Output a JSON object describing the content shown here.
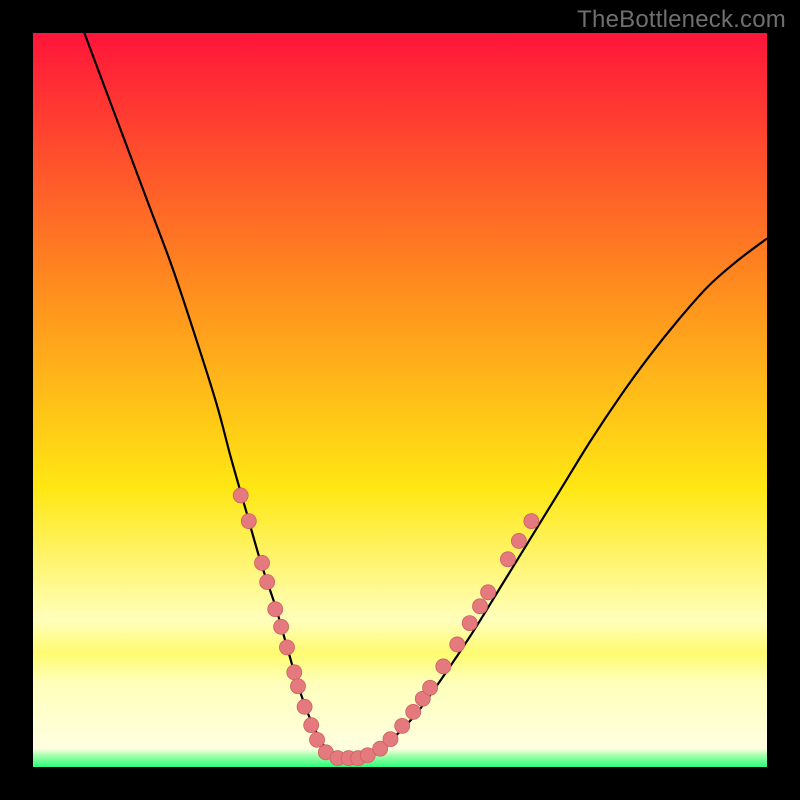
{
  "watermark": {
    "text": "TheBottleneck.com"
  },
  "colors": {
    "black": "#000000",
    "red": "#ff153a",
    "orange": "#ff8a1f",
    "yellow": "#ffe713",
    "paleyellow": "#ffffbb",
    "bandyellow": "#fffb70",
    "green": "#2bff7b",
    "curve": "#000000",
    "marker_fill": "#e47a7d",
    "marker_stroke": "#cf5e62"
  },
  "chart_data": {
    "type": "line",
    "title": "",
    "xlabel": "",
    "ylabel": "",
    "xlim": [
      0,
      100
    ],
    "ylim": [
      0,
      100
    ],
    "series": [
      {
        "name": "bottleneck-curve",
        "x": [
          7,
          10,
          13,
          16,
          19,
          22,
          25,
          27,
          29,
          31,
          33,
          34,
          35,
          36,
          37,
          38,
          39,
          40,
          42,
          45,
          48,
          52,
          56,
          60,
          64,
          68,
          72,
          76,
          80,
          84,
          88,
          92,
          96,
          100
        ],
        "y": [
          100,
          92,
          84,
          76,
          68,
          59,
          49.5,
          42,
          35,
          28,
          22,
          18.5,
          15,
          11.5,
          8.5,
          6,
          4,
          2.5,
          1.2,
          1.2,
          3,
          7,
          12.5,
          18.5,
          25,
          31.5,
          38,
          44.5,
          50.5,
          56,
          61,
          65.5,
          69,
          72
        ]
      }
    ],
    "markers": {
      "name": "highlight-dots",
      "points": [
        {
          "x": 28.3,
          "y": 37.0
        },
        {
          "x": 29.4,
          "y": 33.5
        },
        {
          "x": 31.2,
          "y": 27.8
        },
        {
          "x": 31.9,
          "y": 25.2
        },
        {
          "x": 33.0,
          "y": 21.5
        },
        {
          "x": 33.8,
          "y": 19.1
        },
        {
          "x": 34.6,
          "y": 16.3
        },
        {
          "x": 35.6,
          "y": 12.9
        },
        {
          "x": 36.1,
          "y": 11.0
        },
        {
          "x": 37.0,
          "y": 8.2
        },
        {
          "x": 37.9,
          "y": 5.7
        },
        {
          "x": 38.7,
          "y": 3.7
        },
        {
          "x": 39.9,
          "y": 2.0
        },
        {
          "x": 41.5,
          "y": 1.2
        },
        {
          "x": 43.0,
          "y": 1.2
        },
        {
          "x": 44.3,
          "y": 1.2
        },
        {
          "x": 45.6,
          "y": 1.6
        },
        {
          "x": 47.3,
          "y": 2.5
        },
        {
          "x": 48.7,
          "y": 3.8
        },
        {
          "x": 50.3,
          "y": 5.6
        },
        {
          "x": 51.8,
          "y": 7.5
        },
        {
          "x": 53.1,
          "y": 9.3
        },
        {
          "x": 54.1,
          "y": 10.8
        },
        {
          "x": 55.9,
          "y": 13.7
        },
        {
          "x": 57.8,
          "y": 16.7
        },
        {
          "x": 59.5,
          "y": 19.6
        },
        {
          "x": 60.9,
          "y": 21.9
        },
        {
          "x": 62.0,
          "y": 23.8
        },
        {
          "x": 64.7,
          "y": 28.3
        },
        {
          "x": 66.2,
          "y": 30.8
        },
        {
          "x": 67.9,
          "y": 33.5
        }
      ]
    },
    "gradient_stops": [
      {
        "offset": 0.0,
        "color": "#ff153a"
      },
      {
        "offset": 0.34,
        "color": "#ff8a1f"
      },
      {
        "offset": 0.62,
        "color": "#ffe713"
      },
      {
        "offset": 0.8,
        "color": "#ffffbb"
      },
      {
        "offset": 0.845,
        "color": "#fffb70"
      },
      {
        "offset": 0.885,
        "color": "#ffffbb"
      },
      {
        "offset": 0.975,
        "color": "#ffffe0"
      },
      {
        "offset": 0.985,
        "color": "#9effa8"
      },
      {
        "offset": 1.0,
        "color": "#2bff7b"
      }
    ]
  }
}
